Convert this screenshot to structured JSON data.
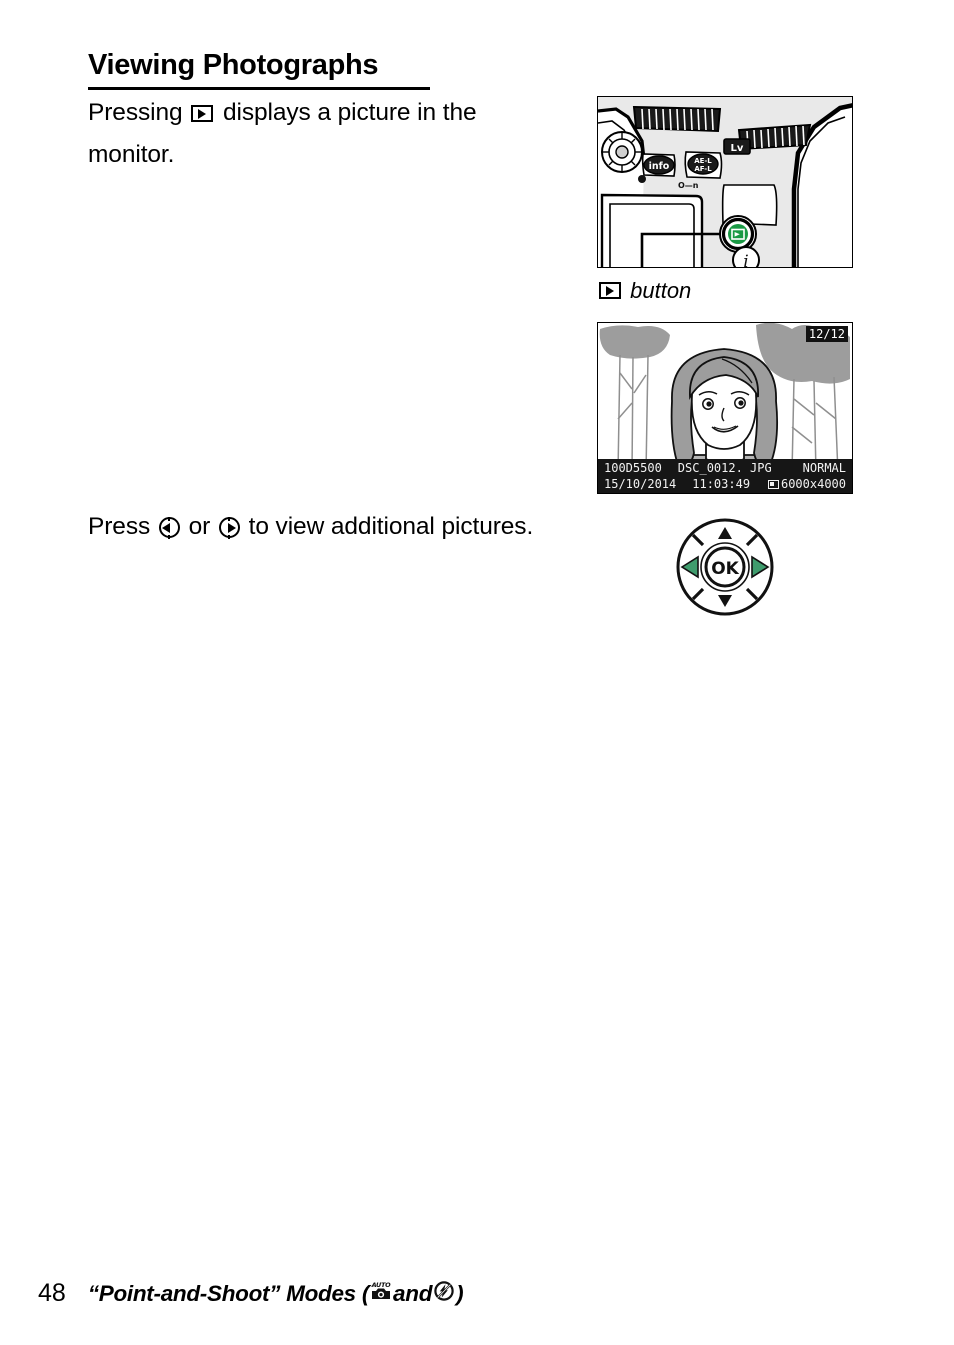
{
  "page": {
    "number": "48",
    "footer_title_prefix": "“Point-and-Shoot” Modes (",
    "footer_title_middle": " and ",
    "footer_title_suffix": ")"
  },
  "heading": {
    "text": "Viewing Photographs"
  },
  "body": {
    "intro_before": "Pressing",
    "intro_after": "displays a picture in the monitor.",
    "press_before": "Press",
    "press_or": "or",
    "press_after": "to view additional pictures."
  },
  "camera_figure": {
    "caption_text": "button",
    "buttons": {
      "info": "info",
      "ae_l_af_l_top": "AE-L",
      "ae_l_af_l_bottom": "AF-L",
      "live_view": "Lv",
      "info_button_i": "i",
      "key_lock": "O–n"
    },
    "background_color": "#e9e9e9",
    "playback_button_color": "#199944"
  },
  "monitor_figure": {
    "frame_counter": "12/12",
    "folder": "100D5500",
    "filename": "DSC_0012. JPG",
    "quality": "NORMAL",
    "date": "15/10/2014",
    "time": "11:03:49",
    "image_size": "6000x4000"
  },
  "selector_figure": {
    "ok_label": "OK",
    "highlight_color": "#3f9c6d",
    "highlighted_directions": [
      "left",
      "right"
    ]
  },
  "icons": {
    "playback": "playback-icon",
    "multi-selector-left": "multi-selector-left-icon",
    "multi-selector-right": "multi-selector-right-icon",
    "auto_mode": "auto-mode-icon",
    "flash_off": "flash-off-icon"
  }
}
